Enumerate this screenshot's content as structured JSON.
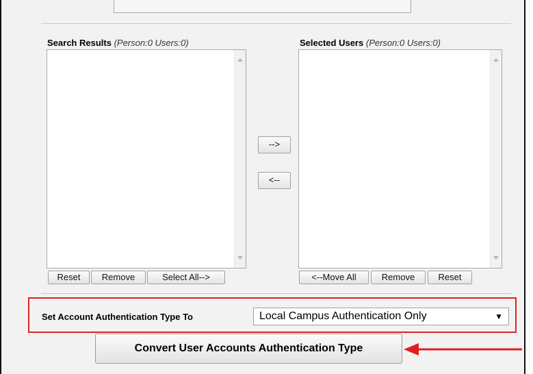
{
  "search_results": {
    "title": "Search Results",
    "counts": "(Person:0 Users:0)",
    "buttons": {
      "reset": "Reset",
      "remove": "Remove",
      "select_all": "Select All-->"
    }
  },
  "selected_users": {
    "title": "Selected Users",
    "counts": "(Person:0 Users:0)",
    "buttons": {
      "move_all": "<--Move All",
      "remove": "Remove",
      "reset": "Reset"
    }
  },
  "transfer": {
    "add": "-->",
    "remove": "<--"
  },
  "auth": {
    "label": "Set Account Authentication Type To",
    "selected": "Local Campus Authentication Only",
    "caret": "▼"
  },
  "convert_button": "Convert User Accounts Authentication Type",
  "colors": {
    "highlight": "#e02020"
  }
}
